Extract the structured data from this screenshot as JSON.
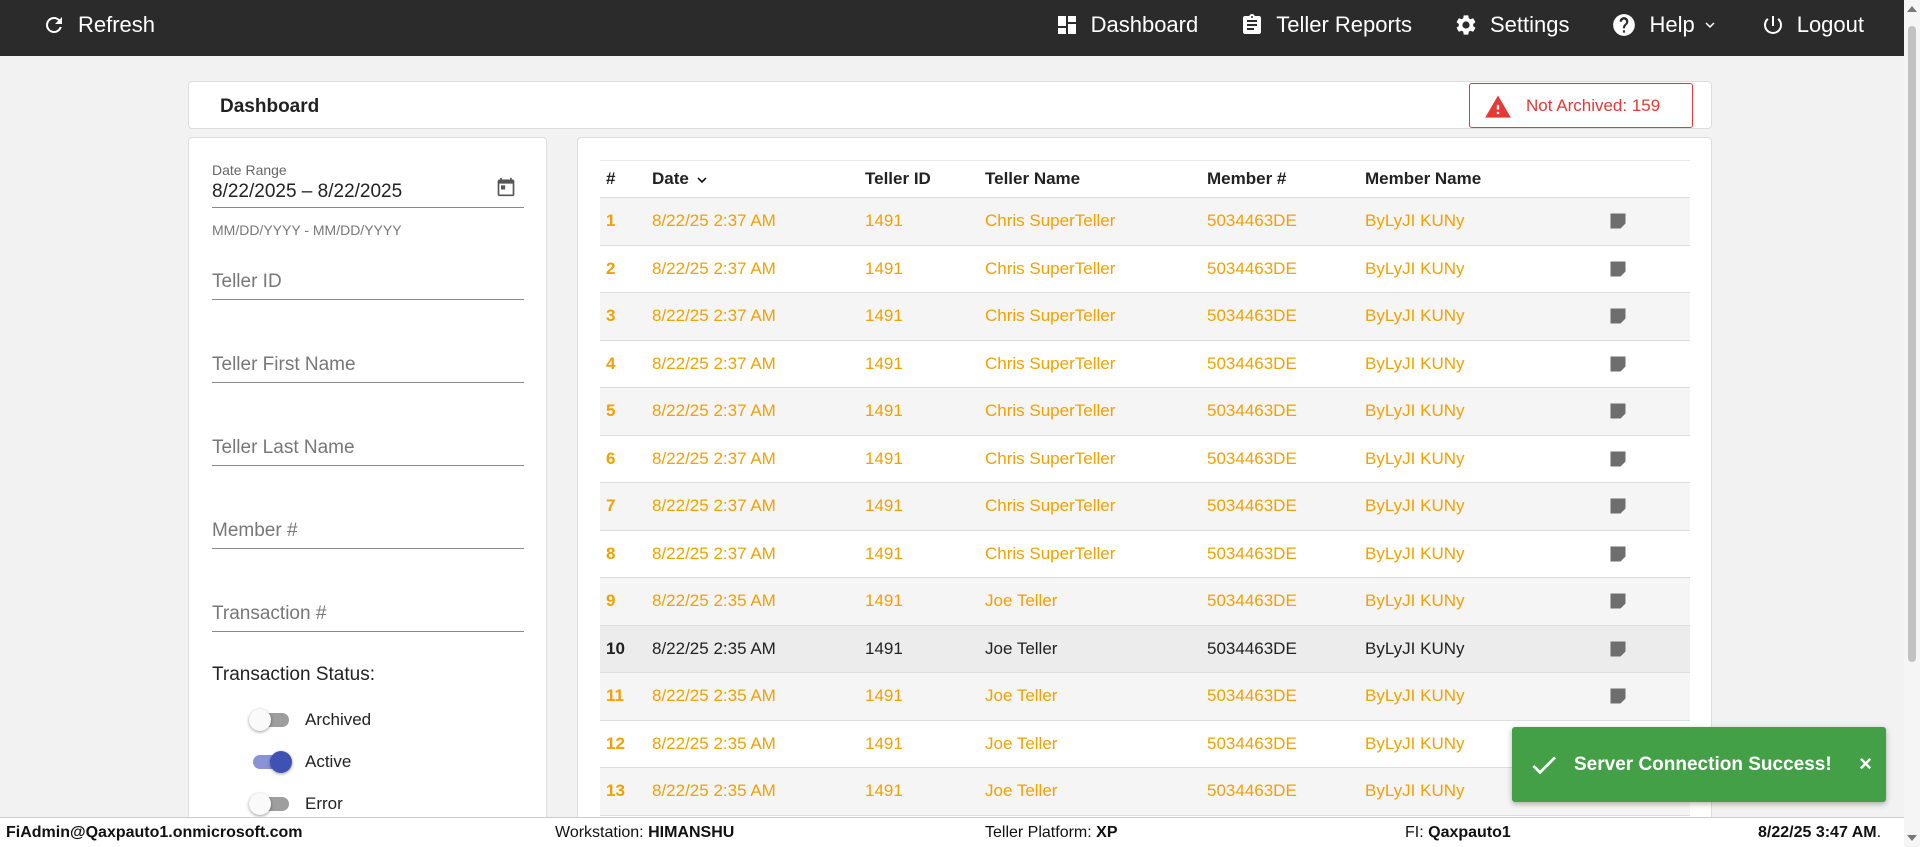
{
  "topbar": {
    "refresh_label": "Refresh",
    "nav": {
      "dashboard": "Dashboard",
      "teller_reports": "Teller Reports",
      "settings": "Settings",
      "help": "Help",
      "logout": "Logout"
    }
  },
  "header": {
    "title": "Dashboard",
    "not_archived": "Not Archived: 159",
    "alert_color": "#e53935"
  },
  "filters": {
    "date_range_label": "Date Range",
    "date_range_value": "8/22/2025 – 8/22/2025",
    "date_hint": "MM/DD/YYYY - MM/DD/YYYY",
    "teller_id": "Teller ID",
    "teller_first_name": "Teller First Name",
    "teller_last_name": "Teller Last Name",
    "member_number": "Member #",
    "transaction_number": "Transaction #",
    "status_title": "Transaction Status:",
    "toggles": [
      {
        "label": "Archived",
        "on": false
      },
      {
        "label": "Active",
        "on": true
      },
      {
        "label": "Error",
        "on": false
      }
    ]
  },
  "table": {
    "columns": [
      "#",
      "Date",
      "Teller ID",
      "Teller Name",
      "Member #",
      "Member Name"
    ],
    "highlight_color": "#f2a100",
    "rows": [
      {
        "num": "1",
        "date": "8/22/25 2:37 AM",
        "teller_id": "1491",
        "teller_name": "Chris SuperTeller",
        "member": "5034463DE",
        "member_name": "ByLyJI KUNy"
      },
      {
        "num": "2",
        "date": "8/22/25 2:37 AM",
        "teller_id": "1491",
        "teller_name": "Chris SuperTeller",
        "member": "5034463DE",
        "member_name": "ByLyJI KUNy"
      },
      {
        "num": "3",
        "date": "8/22/25 2:37 AM",
        "teller_id": "1491",
        "teller_name": "Chris SuperTeller",
        "member": "5034463DE",
        "member_name": "ByLyJI KUNy"
      },
      {
        "num": "4",
        "date": "8/22/25 2:37 AM",
        "teller_id": "1491",
        "teller_name": "Chris SuperTeller",
        "member": "5034463DE",
        "member_name": "ByLyJI KUNy"
      },
      {
        "num": "5",
        "date": "8/22/25 2:37 AM",
        "teller_id": "1491",
        "teller_name": "Chris SuperTeller",
        "member": "5034463DE",
        "member_name": "ByLyJI KUNy"
      },
      {
        "num": "6",
        "date": "8/22/25 2:37 AM",
        "teller_id": "1491",
        "teller_name": "Chris SuperTeller",
        "member": "5034463DE",
        "member_name": "ByLyJI KUNy"
      },
      {
        "num": "7",
        "date": "8/22/25 2:37 AM",
        "teller_id": "1491",
        "teller_name": "Chris SuperTeller",
        "member": "5034463DE",
        "member_name": "ByLyJI KUNy"
      },
      {
        "num": "8",
        "date": "8/22/25 2:37 AM",
        "teller_id": "1491",
        "teller_name": "Chris SuperTeller",
        "member": "5034463DE",
        "member_name": "ByLyJI KUNy"
      },
      {
        "num": "9",
        "date": "8/22/25 2:35 AM",
        "teller_id": "1491",
        "teller_name": "Joe Teller",
        "member": "5034463DE",
        "member_name": "ByLyJI KUNy"
      },
      {
        "num": "10",
        "date": "8/22/25 2:35 AM",
        "teller_id": "1491",
        "teller_name": "Joe Teller",
        "member": "5034463DE",
        "member_name": "ByLyJI KUNy",
        "selected": true
      },
      {
        "num": "11",
        "date": "8/22/25 2:35 AM",
        "teller_id": "1491",
        "teller_name": "Joe Teller",
        "member": "5034463DE",
        "member_name": "ByLyJI KUNy"
      },
      {
        "num": "12",
        "date": "8/22/25 2:35 AM",
        "teller_id": "1491",
        "teller_name": "Joe Teller",
        "member": "5034463DE",
        "member_name": "ByLyJI KUNy"
      },
      {
        "num": "13",
        "date": "8/22/25 2:35 AM",
        "teller_id": "1491",
        "teller_name": "Joe Teller",
        "member": "5034463DE",
        "member_name": "ByLyJI KUNy"
      }
    ]
  },
  "toast": {
    "message": "Server Connection Success!",
    "close": "×",
    "color": "#43a047"
  },
  "statusbar": {
    "user": "FiAdmin@Qaxpauto1.onmicrosoft.com",
    "workstation_label": "Workstation:",
    "workstation": "HIMANSHU",
    "platform_label": "Teller Platform:",
    "platform": "XP",
    "fi_label": "FI:",
    "fi": "Qaxpauto1",
    "datetime": "8/22/25 3:47 AM",
    "datetime_suffix": "."
  }
}
